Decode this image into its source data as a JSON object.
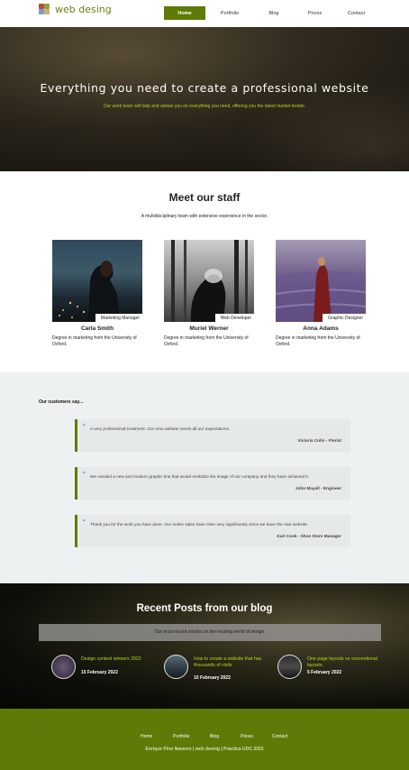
{
  "header": {
    "logo_text": "web desing",
    "nav": [
      {
        "label": "Home",
        "active": true
      },
      {
        "label": "Portfolio",
        "active": false
      },
      {
        "label": "Blog",
        "active": false
      },
      {
        "label": "Prices",
        "active": false
      },
      {
        "label": "Contact",
        "active": false
      }
    ]
  },
  "hero": {
    "title": "Everything you need to create a professional website",
    "subtitle": "Our work team will help and advise you on everything you need, offering you the latest market trends."
  },
  "staff": {
    "title": "Meet our staff",
    "subtitle": "A multidisciplinary team with extensive experience in the sector.",
    "members": [
      {
        "role": "Marketing Manager",
        "name": "Carla Smith",
        "description": "Degree in marketing from the University of Oxford."
      },
      {
        "role": "Web Developer",
        "name": "Muriel Werner",
        "description": "Degree in marketing from the University of Oxford."
      },
      {
        "role": "Graphic Designer",
        "name": "Anna Adams",
        "description": "Degree in marketing from the University of Oxford."
      }
    ]
  },
  "testimonials": {
    "heading": "Our customers say...",
    "items": [
      {
        "text": "A very professional treatment. Our new website meets all our expectations.",
        "author": "Victoria Colin - Florist"
      },
      {
        "text": "We needed a new and modern graphic line that would revitalize the image of our company and they have achieved it.",
        "author": "John Mayall - Engineer"
      },
      {
        "text": "Thank you for the work you have done. Our online sales have risen very significantly since we have the new website.",
        "author": "Karl Cook - Shoe Store Manager"
      }
    ]
  },
  "blog": {
    "title": "Recent Posts from our blog",
    "subtitle": "Our most recent articles on the exciting world of design.",
    "posts": [
      {
        "title": "Design contest winners 2022",
        "date": "15 February 2022"
      },
      {
        "title": "How to create a website that has thousands of visits",
        "date": "10 February 2022"
      },
      {
        "title": "One page layouts vs conventional layouts.",
        "date": "5 February 2022"
      }
    ]
  },
  "footer": {
    "links": [
      "Home",
      "Portfolio",
      "Blog",
      "Prices",
      "Contact"
    ],
    "credit": "Enrique Pino Navarro | web desing | Practica UOC 2022"
  },
  "colors": {
    "brand_green": "#5f7a07",
    "accent_lime": "#b9d81b"
  }
}
